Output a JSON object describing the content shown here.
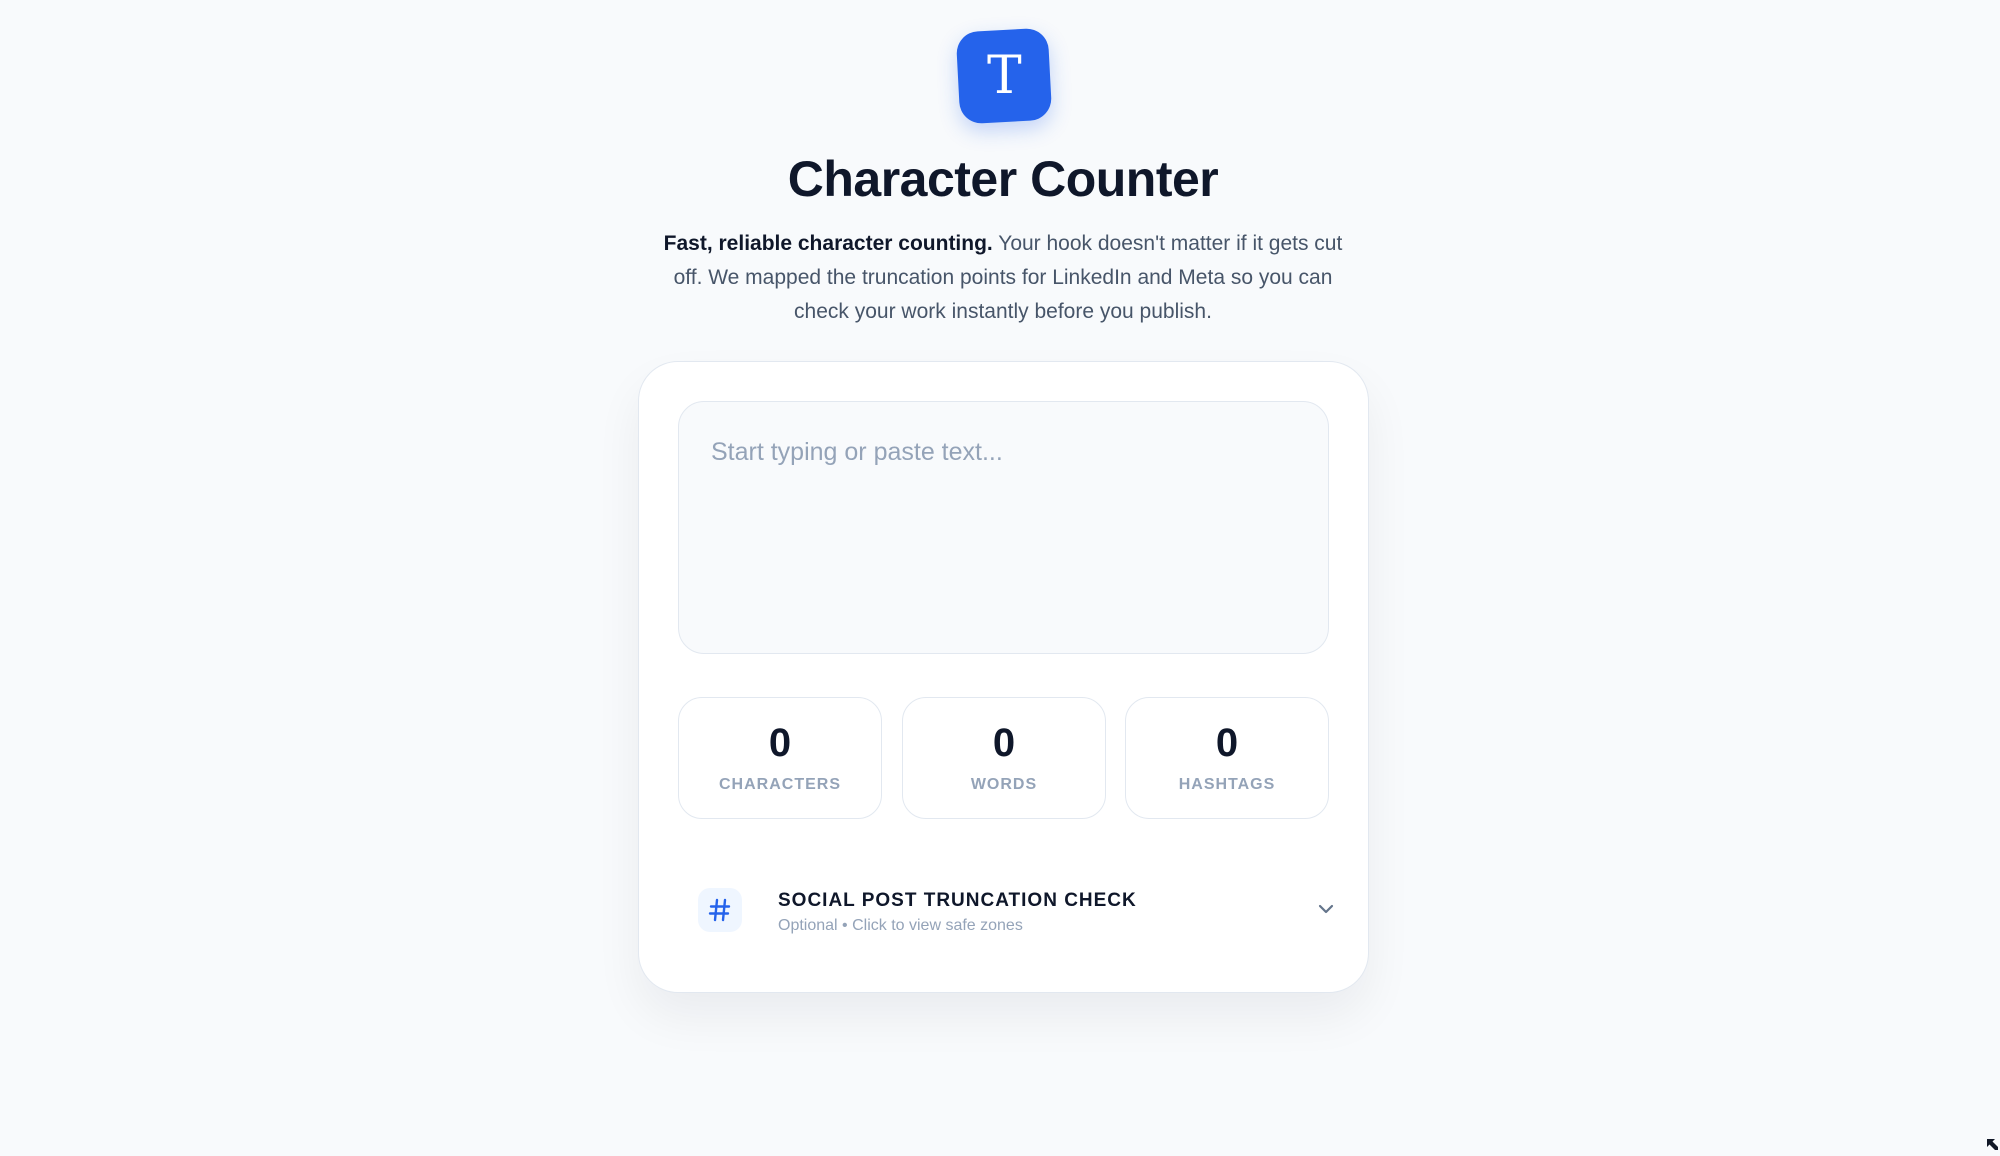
{
  "header": {
    "logo_letter": "T",
    "title": "Character Counter",
    "subtitle_bold": "Fast, reliable character counting.",
    "subtitle_rest": "Your hook doesn't matter if it gets cut off. We mapped the truncation points for LinkedIn and Meta so you can check your work instantly before you publish."
  },
  "editor": {
    "placeholder": "Start typing or paste text...",
    "value": ""
  },
  "stats": [
    {
      "value": "0",
      "label": "CHARACTERS"
    },
    {
      "value": "0",
      "label": "WORDS"
    },
    {
      "value": "0",
      "label": "HASHTAGS"
    }
  ],
  "truncation": {
    "icon": "hash-icon",
    "title": "SOCIAL POST TRUNCATION CHECK",
    "subtitle": "Optional • Click to view safe zones",
    "expanded": false
  },
  "colors": {
    "accent": "#2563eb",
    "background": "#f8fafc",
    "text": "#0f172a",
    "muted": "#94a3b8",
    "border": "#e2e8f0"
  }
}
